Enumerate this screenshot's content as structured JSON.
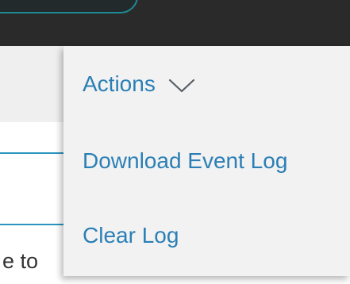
{
  "background_text": {
    "partial": "e to"
  },
  "dropdown": {
    "title": "Actions",
    "title_icon": "chevron-down-icon",
    "items": [
      {
        "label": "Download Event Log"
      },
      {
        "label": "Clear Log"
      }
    ]
  },
  "colors": {
    "link": "#2b7fb5",
    "topbar": "#2a2a2a",
    "accent_teal": "#1e8a94",
    "menu_bg": "#f2f2f2",
    "divider": "#2a95bf"
  }
}
